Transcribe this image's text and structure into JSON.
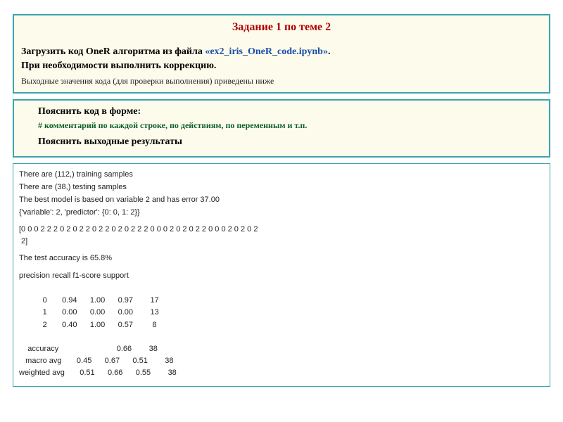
{
  "panel1": {
    "title": "Задание 1 по теме 2",
    "line1_prefix": "Загрузить код OneR алгоритма из файла ",
    "line1_file": "«ex2_iris_OneR_code.ipynb»",
    "line1_suffix": ".",
    "line2": "При необходимости выполнить коррекцию.",
    "note": "Выходные значения кода (для проверки выполнения) приведены ниже"
  },
  "panel2": {
    "head": "Пояснить код в форме:",
    "comment": "# комментарий по каждой строке, по действиям, по переменным и т.п.",
    "head2": "Пояснить выходные результаты"
  },
  "output": {
    "l1": "There are (112,) training samples",
    "l2": "There are (38,) testing samples",
    "l3": "The best model is based on variable 2 and has error 37.00",
    "l4": "{'variable': 2, 'predictor': {0: 0, 1: 2}}",
    "array": "[0 0 0 2 2 2 0 2 0 2 2 0 2 2 0 2 0 2 2 2 0 0 0 2 0 2 0 2 2 0 0 0 2 0 2 0 2\n 2]",
    "acc": "The test accuracy is 65.8%",
    "report_header": "precision    recall  f1-score   support",
    "report_body": "\n           0       0.94      1.00      0.97        17\n           1       0.00      0.00      0.00        13\n           2       0.40      1.00      0.57         8\n\n    accuracy                           0.66        38\n   macro avg       0.45      0.67      0.51        38\nweighted avg       0.51      0.66      0.55        38"
  }
}
